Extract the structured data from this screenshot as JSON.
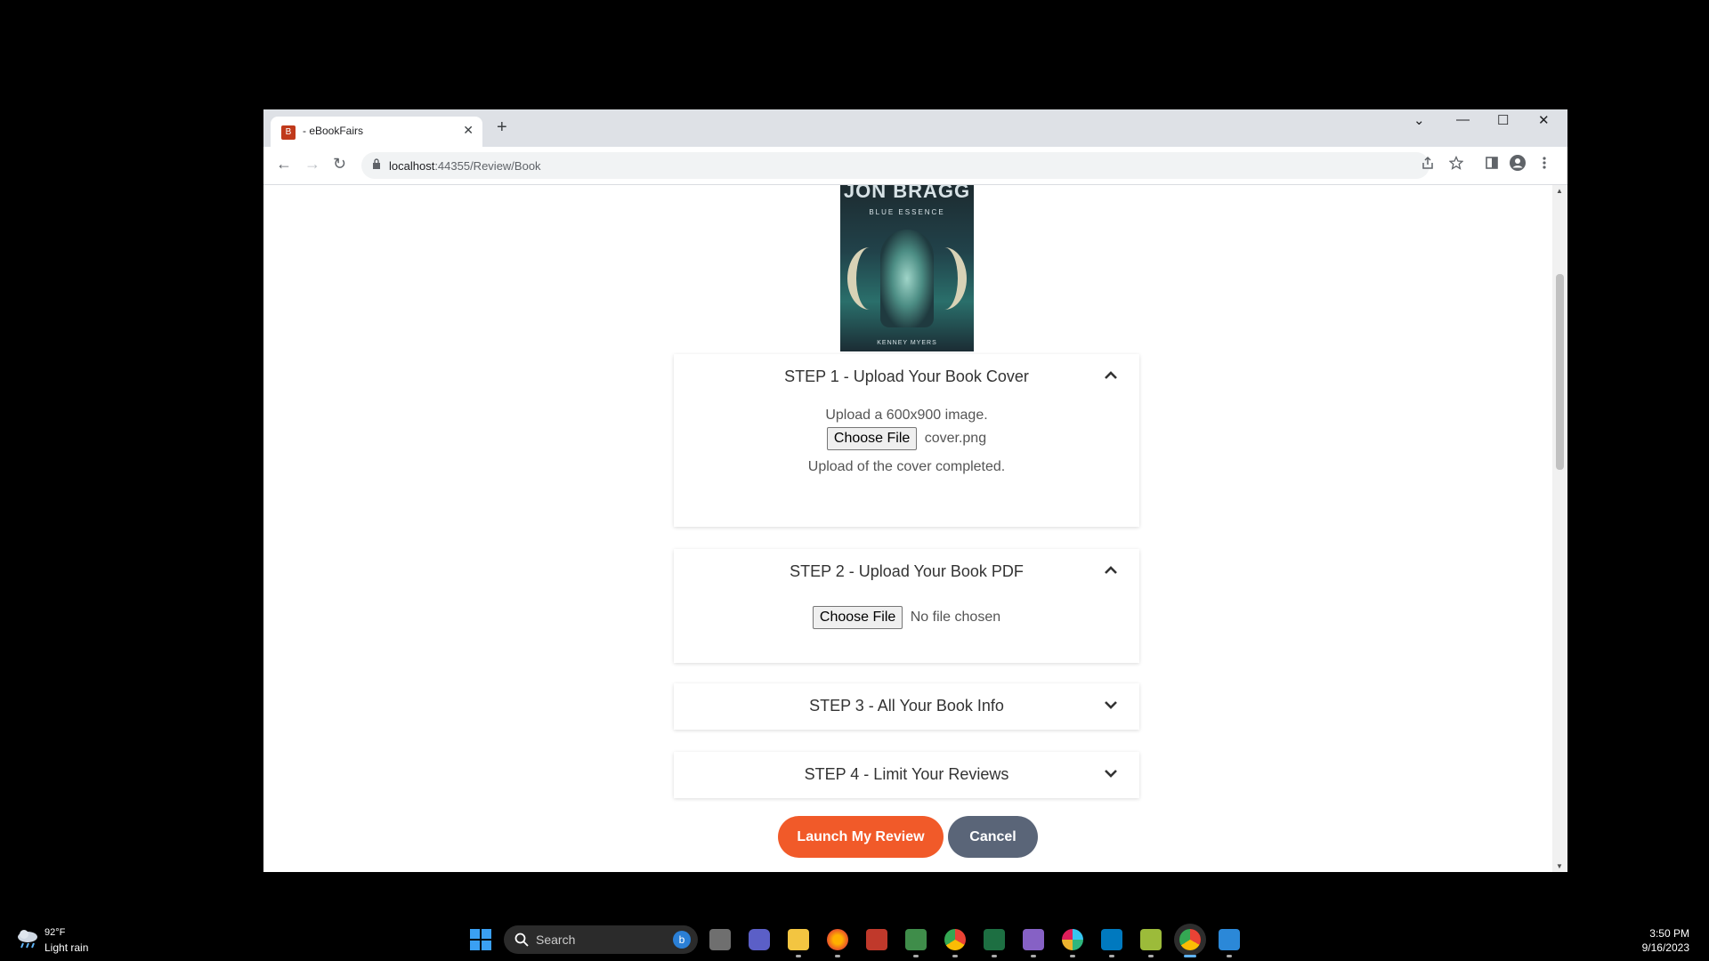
{
  "browser": {
    "tab_title": "- eBookFairs",
    "tab_favicon_letter": "B",
    "tab_close": "✕",
    "new_tab": "+",
    "win_dropdown": "⌄",
    "win_minimize": "—",
    "win_maximize": "☐",
    "win_close": "✕",
    "url_host": "localhost",
    "url_path": ":44355/Review/Book",
    "nav_back": "←",
    "nav_forward": "→",
    "nav_reload": "↻"
  },
  "cover": {
    "title": "JON BRAGG",
    "subtitle": "BLUE ESSENCE",
    "author": "KENNEY MYERS"
  },
  "steps": [
    {
      "title": "STEP 1 - Upload Your Book Cover",
      "expanded": true,
      "instructions": "Upload a 600x900 image.",
      "file_button": "Choose File",
      "file_name": "cover.png",
      "status": "Upload of the cover completed."
    },
    {
      "title": "STEP 2 - Upload Your Book PDF",
      "expanded": true,
      "file_button": "Choose File",
      "file_name": "No file chosen"
    },
    {
      "title": "STEP 3 - All Your Book Info",
      "expanded": false
    },
    {
      "title": "STEP 4 - Limit Your Reviews",
      "expanded": false
    }
  ],
  "actions": {
    "launch": "Launch My Review",
    "cancel": "Cancel"
  },
  "colors": {
    "launch_button": "#f15a29",
    "cancel_button": "#5a6578"
  },
  "taskbar": {
    "weather_temp": "92°F",
    "weather_condition": "Light rain",
    "search_placeholder": "Search",
    "bing_label": "b",
    "time": "3:50 PM",
    "date": "9/16/2023"
  }
}
